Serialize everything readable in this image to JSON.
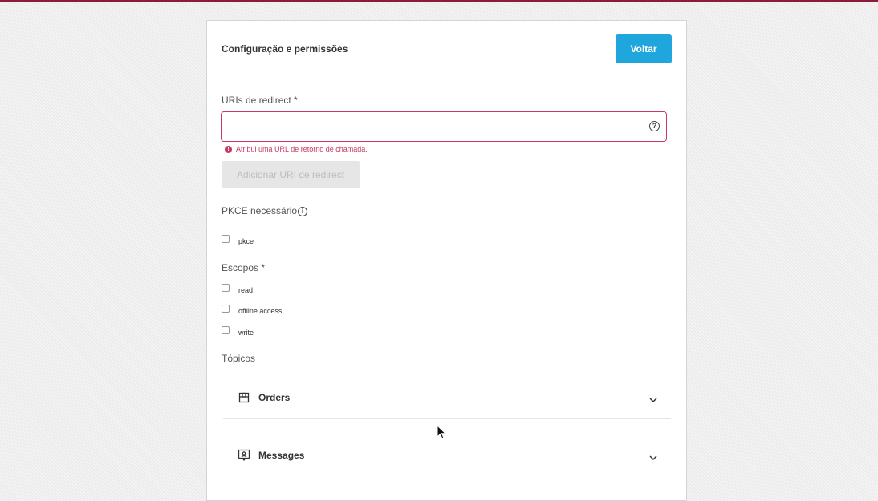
{
  "header": {
    "title": "Configuração e permissões",
    "back_label": "Voltar"
  },
  "redirect": {
    "label": "URIs de redirect *",
    "value": "",
    "error": "Atribui uma URL de retorno de chamada.",
    "add_label": "Adicionar URI de redirect"
  },
  "pkce": {
    "label": "PKCE necessário",
    "options": [
      {
        "label": "pkce",
        "checked": false
      }
    ]
  },
  "scopes": {
    "label": "Escopos *",
    "options": [
      {
        "label": "read",
        "checked": false
      },
      {
        "label": "offline access",
        "checked": false
      },
      {
        "label": "write",
        "checked": false
      }
    ]
  },
  "topics": {
    "label": "Tópicos",
    "items": [
      {
        "label": "Orders",
        "icon": "box-icon"
      },
      {
        "label": "Messages",
        "icon": "chat-icon"
      }
    ]
  },
  "colors": {
    "accent": "#1fa6dd",
    "error": "#c8385f",
    "top_border": "#8e1a3a"
  }
}
